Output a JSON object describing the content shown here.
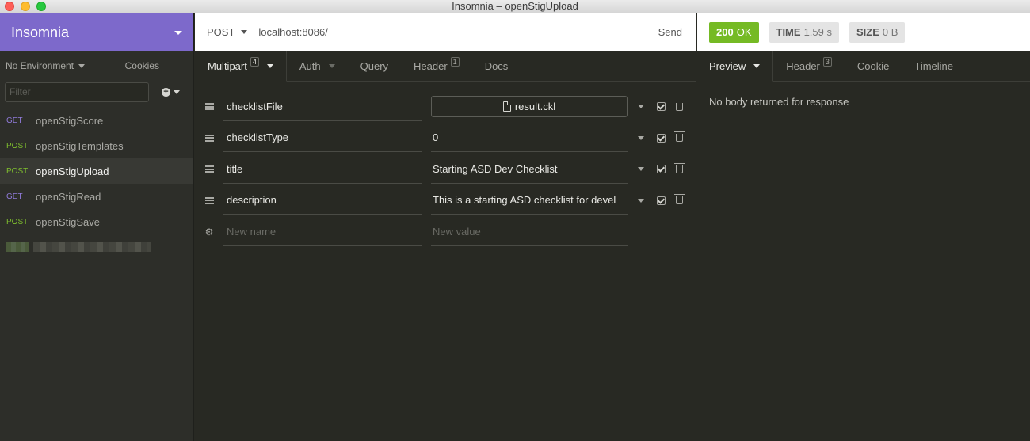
{
  "window": {
    "title": "Insomnia – openStigUpload"
  },
  "sidebar": {
    "workspace": "Insomnia",
    "environment": "No Environment",
    "cookies": "Cookies",
    "filter_placeholder": "Filter",
    "requests": [
      {
        "method": "GET",
        "name": "openStigScore"
      },
      {
        "method": "POST",
        "name": "openStigTemplates"
      },
      {
        "method": "POST",
        "name": "openStigUpload",
        "active": true
      },
      {
        "method": "GET",
        "name": "openStigRead"
      },
      {
        "method": "POST",
        "name": "openStigSave"
      }
    ]
  },
  "request": {
    "method": "POST",
    "url": "localhost:8086/",
    "send_label": "Send",
    "tabs": [
      {
        "label": "Multipart",
        "count": "4"
      },
      {
        "label": "Auth"
      },
      {
        "label": "Query"
      },
      {
        "label": "Header",
        "count": "1"
      },
      {
        "label": "Docs"
      }
    ],
    "params": [
      {
        "name": "checklistFile",
        "value": "result.ckl",
        "type": "file"
      },
      {
        "name": "checklistType",
        "value": "0"
      },
      {
        "name": "title",
        "value": "Starting ASD Dev Checklist"
      },
      {
        "name": "description",
        "value": "This is a starting ASD checklist for devel"
      }
    ],
    "new_name_placeholder": "New name",
    "new_value_placeholder": "New value"
  },
  "response": {
    "status_code": "200",
    "status_text": "OK",
    "time_label": "TIME",
    "time_value": "1.59 s",
    "size_label": "SIZE",
    "size_value": "0 B",
    "tabs": [
      {
        "label": "Preview"
      },
      {
        "label": "Header",
        "count": "3"
      },
      {
        "label": "Cookie"
      },
      {
        "label": "Timeline"
      }
    ],
    "body_message": "No body returned for response"
  },
  "colors": {
    "workspace_header": "#7d69cb",
    "method_get": "#8f7ad8",
    "method_post": "#7fbf2e",
    "status_ok": "#75ba24"
  }
}
